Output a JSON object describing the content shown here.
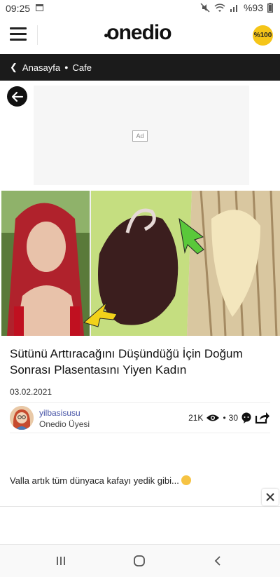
{
  "status_bar": {
    "time": "09:25",
    "battery": "%93"
  },
  "header": {
    "logo": "onedio",
    "badge": "%100"
  },
  "breadcrumb": {
    "home": "Anasayfa",
    "category": "Cafe"
  },
  "ad": {
    "label": "Ad"
  },
  "article": {
    "title": "Sütünü Arttıracağını Düşündüğü İçin Doğum Sonrası Plasentasını Yiyen Kadın",
    "date": "03.02.2021",
    "author_name": "yilbasisusu",
    "author_role": "Onedio Üyesi",
    "views": "21K",
    "separator": "•",
    "comments": "30",
    "body": "Valla artık tüm dünyaca kafayı yedik gibi..."
  },
  "icons": {
    "menu": "hamburger-menu-icon",
    "back": "arrow-left-icon",
    "views": "eye-icon",
    "comments": "comment-icon",
    "share": "share-icon",
    "close": "close-icon"
  },
  "colors": {
    "crumb_bg": "#1b1b1b",
    "badge": "#f5c518",
    "author_link": "#4653a6"
  }
}
